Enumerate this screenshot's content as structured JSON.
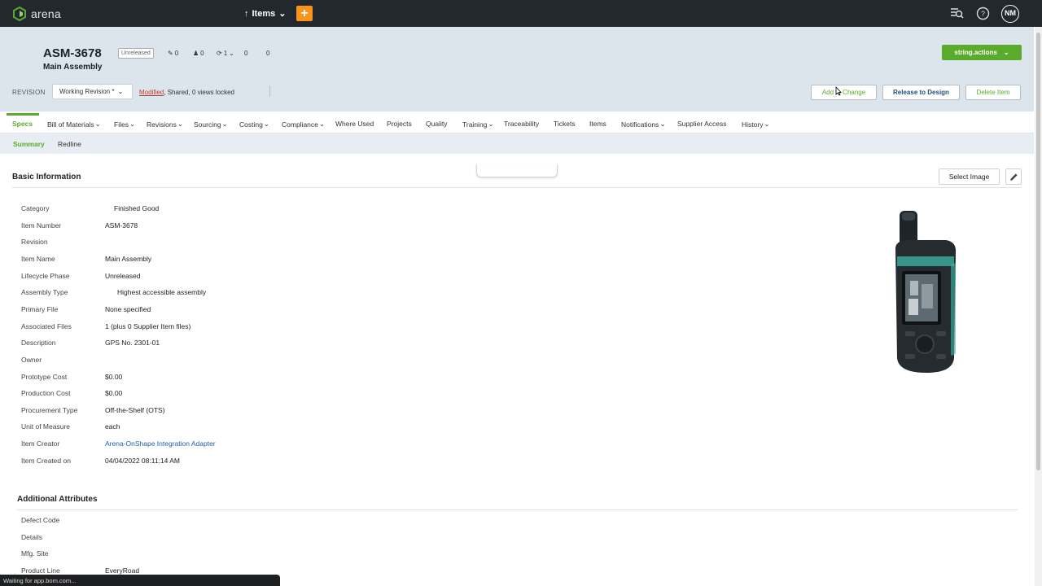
{
  "app": {
    "name": "arena",
    "items_menu": "Items",
    "plus": "+",
    "user_initials": "NM"
  },
  "header": {
    "item_number": "ASM-3678",
    "status": "Unreleased",
    "item_name": "Main Assembly",
    "counters": {
      "changes": "0",
      "users": "0",
      "cycles": "1",
      "a": "0",
      "b": "0"
    },
    "actions_label": "string.actions",
    "revision_label": "REVISION",
    "revision_value": "Working Revision *",
    "revision_status_modified": "Modified",
    "revision_status_rest": ", Shared, 0 views locked",
    "buttons": {
      "add_to_change": "Add to Change",
      "release": "Release to Design",
      "delete": "Delete Item"
    }
  },
  "tabs": [
    {
      "label": "Specs",
      "dropdown": false
    },
    {
      "label": "Bill of Materials",
      "dropdown": true
    },
    {
      "label": "Files",
      "dropdown": true
    },
    {
      "label": "Revisions",
      "dropdown": true
    },
    {
      "label": "Sourcing",
      "dropdown": true
    },
    {
      "label": "Costing",
      "dropdown": true
    },
    {
      "label": "Compliance",
      "dropdown": true
    },
    {
      "label": "Where Used",
      "dropdown": false
    },
    {
      "label": "Projects",
      "dropdown": false
    },
    {
      "label": "Quality",
      "dropdown": false
    },
    {
      "label": "Training",
      "dropdown": true
    },
    {
      "label": "Traceability",
      "dropdown": false
    },
    {
      "label": "Tickets",
      "dropdown": false
    },
    {
      "label": "Items",
      "dropdown": false
    },
    {
      "label": "Notifications",
      "dropdown": true
    },
    {
      "label": "Supplier Access",
      "dropdown": false
    },
    {
      "label": "History",
      "dropdown": true
    }
  ],
  "subtabs": [
    "Summary",
    "Redline"
  ],
  "basic_info": {
    "title": "Basic Information",
    "select_image": "Select Image",
    "fields": [
      {
        "label": "Category",
        "value": "Finished Good"
      },
      {
        "label": "Item Number",
        "value": "ASM-3678"
      },
      {
        "label": "Revision",
        "value": ""
      },
      {
        "label": "Item Name",
        "value": "Main Assembly"
      },
      {
        "label": "Lifecycle Phase",
        "value": "Unreleased"
      },
      {
        "label": "Assembly Type",
        "value": "Highest accessible assembly"
      },
      {
        "label": "Primary File",
        "value": "None specified"
      },
      {
        "label": "Associated Files",
        "value": "1 (plus 0 Supplier Item files)"
      },
      {
        "label": "Description",
        "value": "GPS No. 2301-01"
      },
      {
        "label": "Owner",
        "value": ""
      },
      {
        "label": "Prototype Cost",
        "value": "$0.00"
      },
      {
        "label": "Production Cost",
        "value": "$0.00"
      },
      {
        "label": "Procurement Type",
        "value": "Off-the-Shelf (OTS)"
      },
      {
        "label": "Unit of Measure",
        "value": "each"
      },
      {
        "label": "Item Creator",
        "value": "Arena-OnShape Integration Adapter"
      },
      {
        "label": "Item Created on",
        "value": "04/04/2022 08:11:14 AM"
      }
    ]
  },
  "additional": {
    "title": "Additional Attributes",
    "fields": [
      {
        "label": "Defect Code",
        "value": ""
      },
      {
        "label": "Details",
        "value": ""
      },
      {
        "label": "Mfg. Site",
        "value": ""
      },
      {
        "label": "Product Line",
        "value": "EveryRoad"
      }
    ]
  },
  "statusbar": "Waiting for app.bom.com...",
  "colors": {
    "accent_green": "#5aab2c",
    "nav_dark": "#23282e",
    "header_bg": "#dce5ec",
    "plus_orange": "#f7941d"
  }
}
